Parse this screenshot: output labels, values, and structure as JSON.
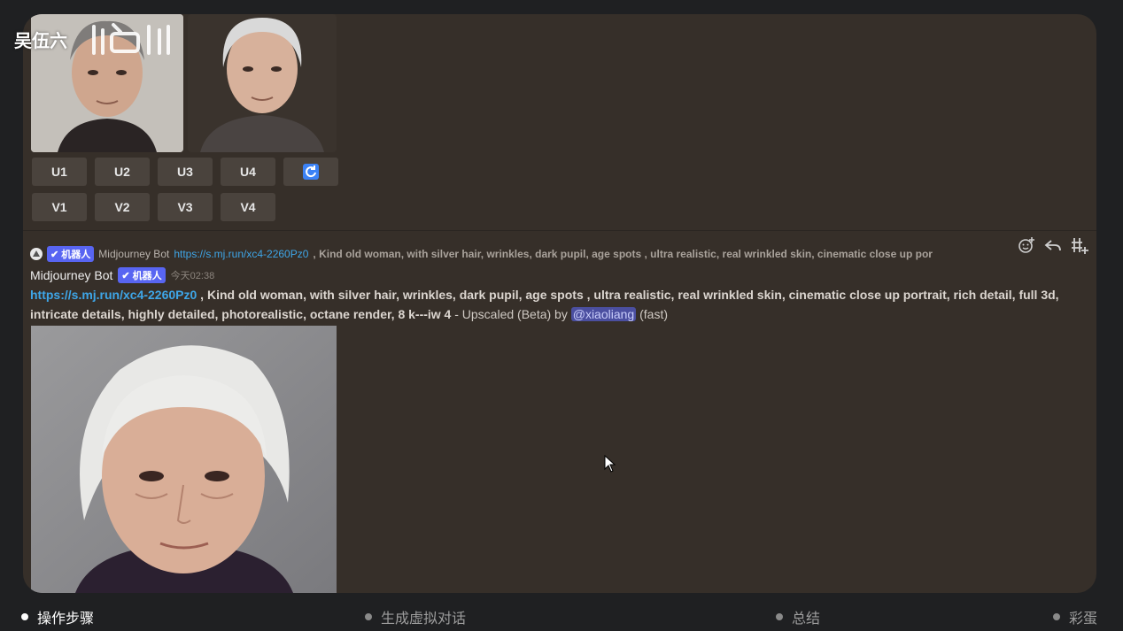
{
  "watermark": {
    "author": "吴伍六"
  },
  "grid_buttons": {
    "upscale": [
      "U1",
      "U2",
      "U3",
      "U4"
    ],
    "variation": [
      "V1",
      "V2",
      "V3",
      "V4"
    ],
    "reroll_icon": "refresh-icon"
  },
  "reply": {
    "tag": "✔ 机器人",
    "author": "Midjourney Bot",
    "link": "https://s.mj.run/xc4-2260Pz0",
    "text": ", Kind old woman, with silver hair, wrinkles, dark pupil, age spots , ultra realistic, real wrinkled skin, cinematic close up por"
  },
  "message": {
    "author": "Midjourney Bot",
    "tag": "✔ 机器人",
    "timestamp": "今天02:38",
    "link": "https://s.mj.run/xc4-2260Pz0",
    "prompt": " , Kind old woman, with silver hair, wrinkles, dark pupil, age spots , ultra realistic, real wrinkled skin, cinematic close up portrait, rich detail, full 3d, intricate details, highly detailed, photorealistic, octane render, 8 k---iw 4",
    "suffix": " - Upscaled (Beta) by ",
    "mention": "@xiaoliang",
    "speed": " (fast)"
  },
  "bottom_nav": [
    {
      "label": "操作步骤",
      "active": true
    },
    {
      "label": "生成虚拟对话",
      "active": false
    },
    {
      "label": "总结",
      "active": false
    },
    {
      "label": "彩蛋",
      "active": false
    }
  ],
  "colors": {
    "panel": "#362f29",
    "accent_blue": "#5865f2",
    "link": "#3ea6e8"
  }
}
